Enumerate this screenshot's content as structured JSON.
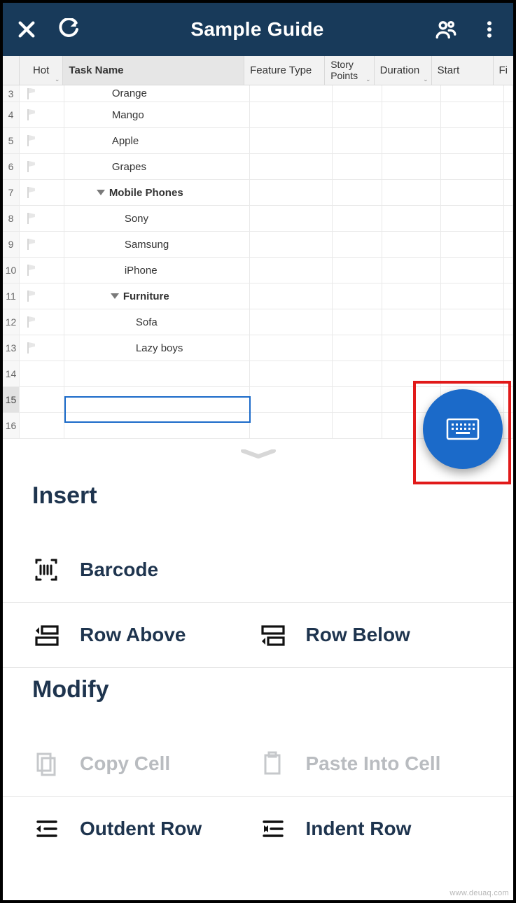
{
  "appbar": {
    "title": "Sample Guide"
  },
  "columns": {
    "hot": "Hot",
    "task": "Task Name",
    "feature": "Feature Type",
    "story": "Story Points",
    "duration": "Duration",
    "start": "Start",
    "last": "Fi"
  },
  "rows": [
    {
      "num": "3",
      "label": "Orange",
      "indent": "indent-0",
      "flag": true,
      "cut": true
    },
    {
      "num": "4",
      "label": "Mango",
      "indent": "indent-0",
      "flag": true
    },
    {
      "num": "5",
      "label": "Apple",
      "indent": "indent-0",
      "flag": true
    },
    {
      "num": "6",
      "label": "Grapes",
      "indent": "indent-0",
      "flag": true
    },
    {
      "num": "7",
      "label": "Mobile Phones",
      "indent": "indent-g",
      "flag": true,
      "group": true
    },
    {
      "num": "8",
      "label": "Sony",
      "indent": "indent-1",
      "flag": true
    },
    {
      "num": "9",
      "label": "Samsung",
      "indent": "indent-1",
      "flag": true
    },
    {
      "num": "10",
      "label": "iPhone",
      "indent": "indent-1",
      "flag": true
    },
    {
      "num": "11",
      "label": "Furniture",
      "indent": "indent-g2",
      "flag": true,
      "group": true
    },
    {
      "num": "12",
      "label": "Sofa",
      "indent": "indent-2",
      "flag": true
    },
    {
      "num": "13",
      "label": "Lazy boys",
      "indent": "indent-2",
      "flag": true
    },
    {
      "num": "14",
      "label": "",
      "indent": "indent-0",
      "flag": false
    },
    {
      "num": "15",
      "label": "",
      "indent": "indent-0",
      "flag": false,
      "selected": true
    },
    {
      "num": "16",
      "label": "",
      "indent": "indent-0",
      "flag": false
    }
  ],
  "sheet": {
    "insert_title": "Insert",
    "modify_title": "Modify",
    "barcode": "Barcode",
    "row_above": "Row Above",
    "row_below": "Row Below",
    "copy_cell": "Copy Cell",
    "paste_cell": "Paste Into Cell",
    "outdent": "Outdent Row",
    "indent": "Indent Row"
  },
  "watermark": "www.deuaq.com"
}
